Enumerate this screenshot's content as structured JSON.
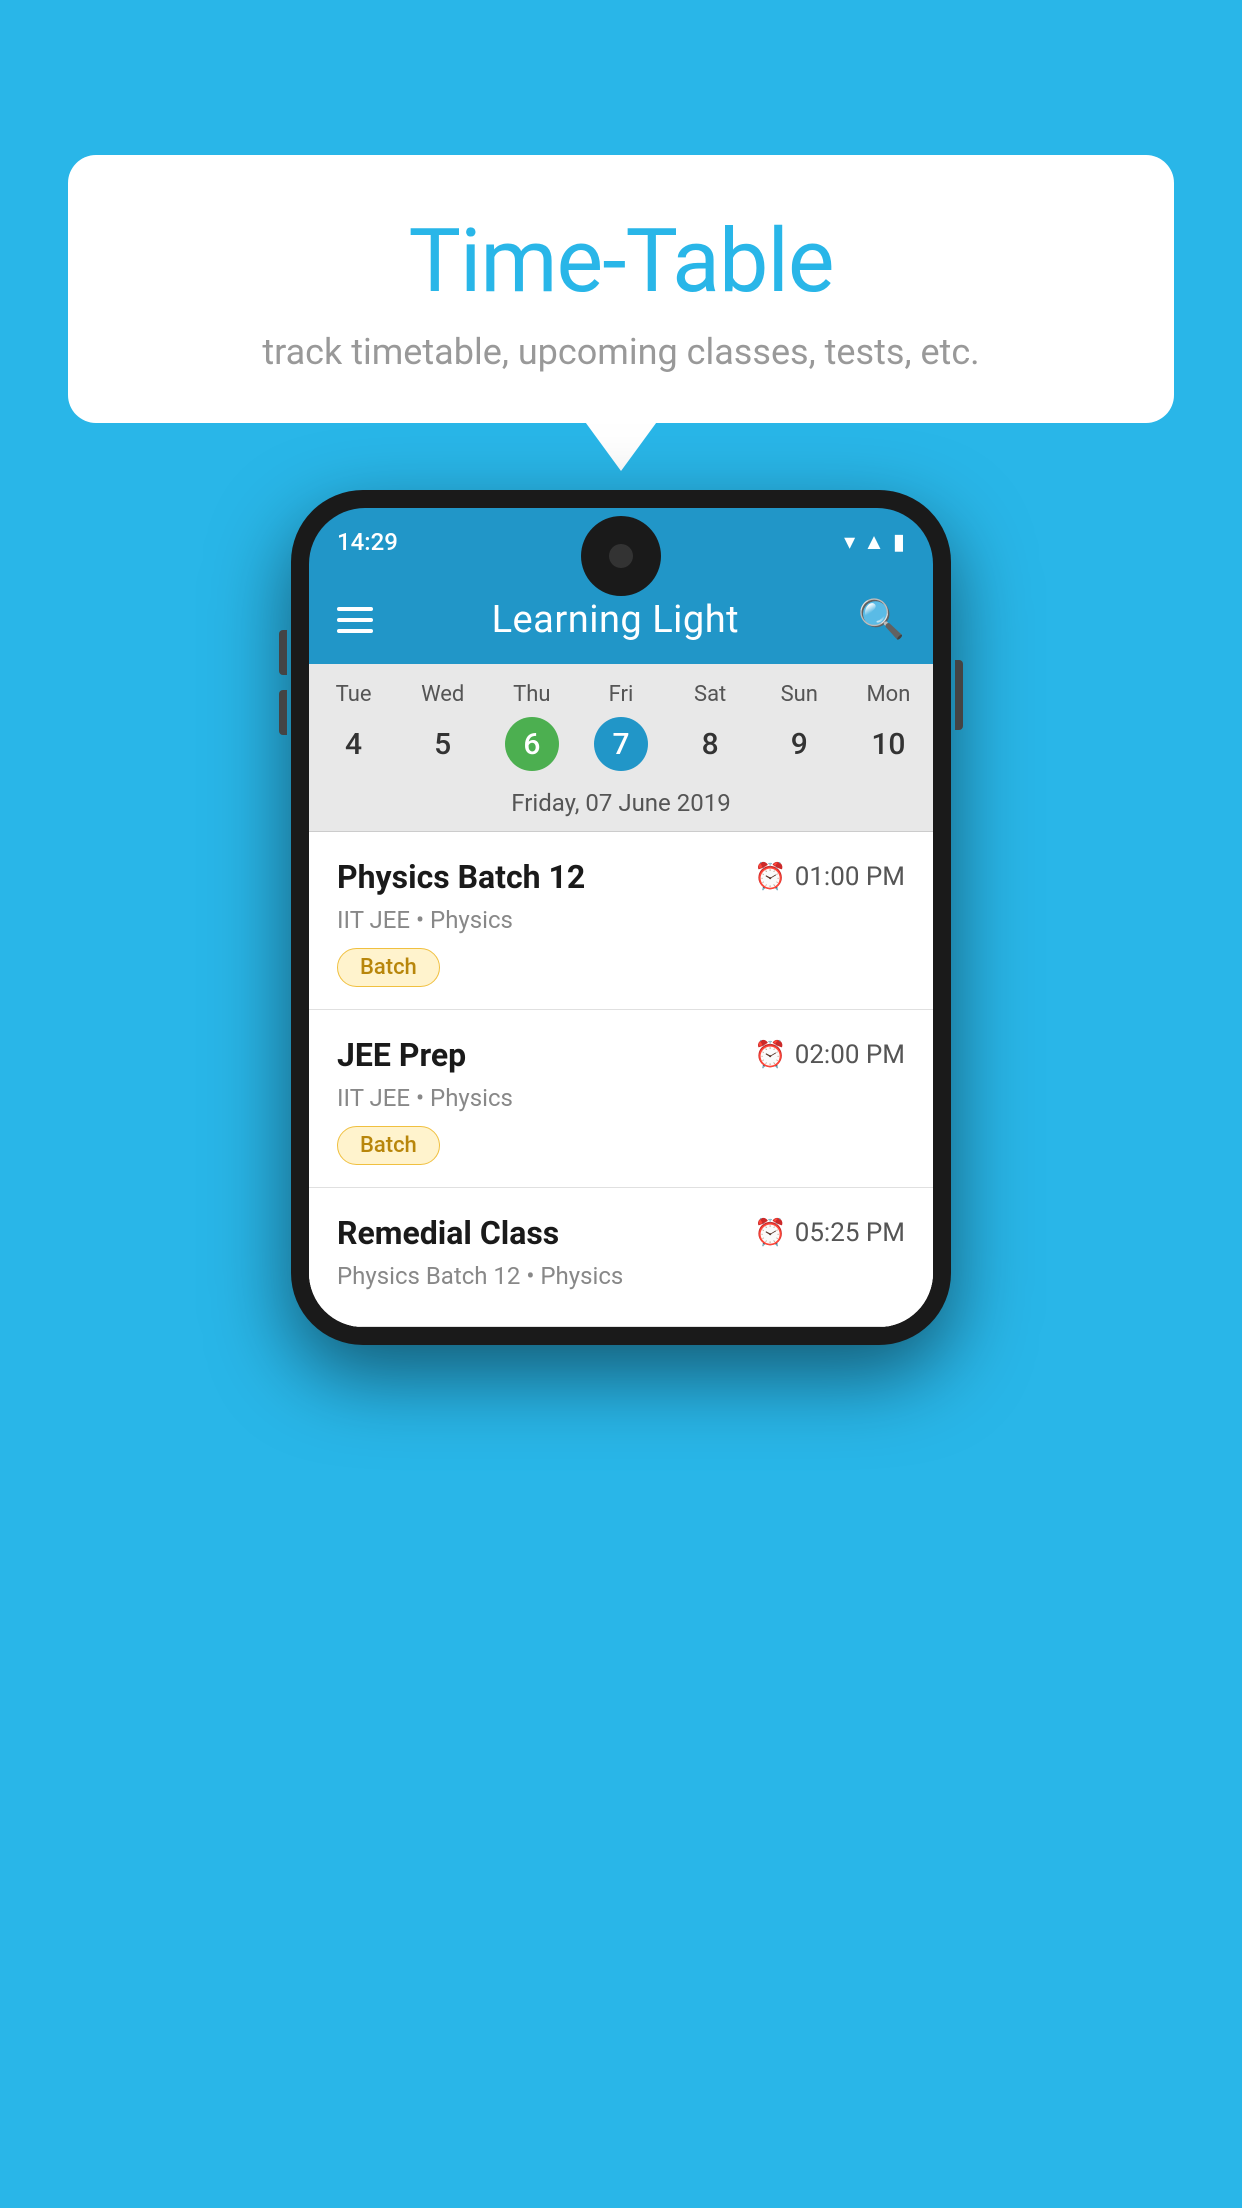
{
  "background_color": "#29B6E8",
  "bubble": {
    "title": "Time-Table",
    "subtitle": "track timetable, upcoming classes, tests, etc."
  },
  "phone": {
    "status_bar": {
      "time": "14:29"
    },
    "app_header": {
      "title": "Learning Light"
    },
    "calendar": {
      "days": [
        {
          "name": "Tue",
          "num": "4",
          "state": "normal"
        },
        {
          "name": "Wed",
          "num": "5",
          "state": "normal"
        },
        {
          "name": "Thu",
          "num": "6",
          "state": "today"
        },
        {
          "name": "Fri",
          "num": "7",
          "state": "selected"
        },
        {
          "name": "Sat",
          "num": "8",
          "state": "normal"
        },
        {
          "name": "Sun",
          "num": "9",
          "state": "normal"
        },
        {
          "name": "Mon",
          "num": "10",
          "state": "normal"
        }
      ],
      "selected_date_label": "Friday, 07 June 2019"
    },
    "schedule": [
      {
        "title": "Physics Batch 12",
        "time": "01:00 PM",
        "subtitle": "IIT JEE • Physics",
        "tag": "Batch"
      },
      {
        "title": "JEE Prep",
        "time": "02:00 PM",
        "subtitle": "IIT JEE • Physics",
        "tag": "Batch"
      },
      {
        "title": "Remedial Class",
        "time": "05:25 PM",
        "subtitle": "Physics Batch 12 • Physics",
        "tag": null
      }
    ]
  }
}
